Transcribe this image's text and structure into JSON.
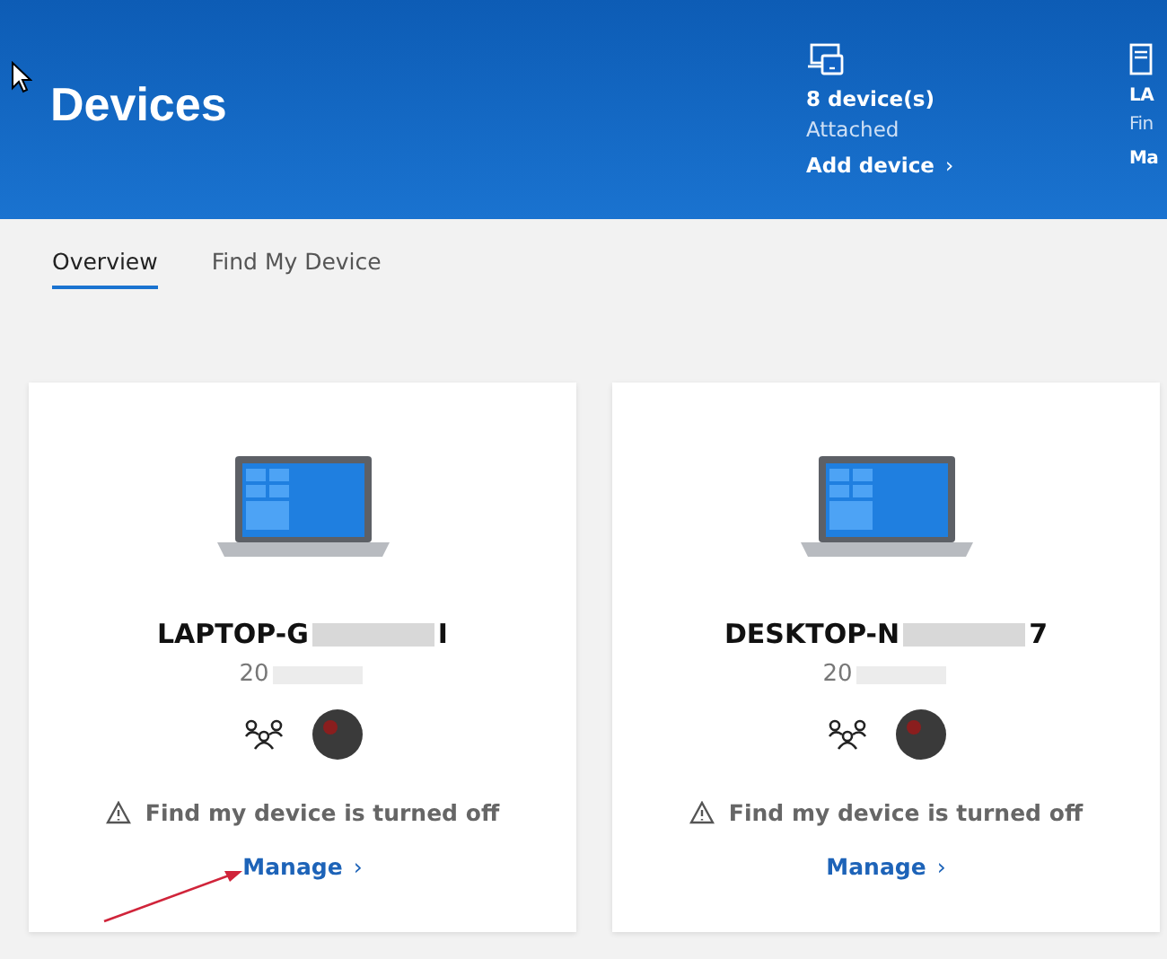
{
  "header": {
    "title": "Devices",
    "stats": [
      {
        "count": "8 device(s)",
        "label": "Attached",
        "link": "Add device",
        "chevron": "›"
      },
      {
        "count": "LA",
        "label": "Fin",
        "link": "Ma"
      }
    ]
  },
  "tabs": [
    {
      "label": "Overview",
      "selected": true
    },
    {
      "label": "Find My Device",
      "selected": false
    }
  ],
  "devices": [
    {
      "name_start": "LAPTOP-G",
      "name_end": "I",
      "serial": "20",
      "warning": "Find my device is turned off",
      "link": "Manage",
      "chevron": "›"
    },
    {
      "name_start": "DESKTOP-N",
      "name_end": "7",
      "serial": "20",
      "warning": "Find my device is turned off",
      "link": "Manage",
      "chevron": "›"
    }
  ]
}
